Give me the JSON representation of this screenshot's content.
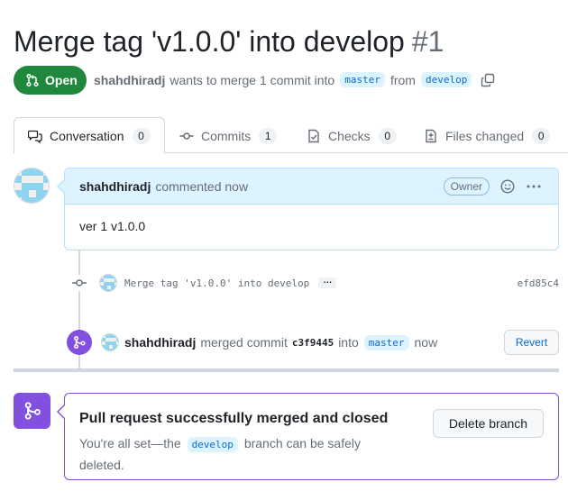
{
  "pr": {
    "title": "Merge tag 'v1.0.0' into develop",
    "number": "#1",
    "state": "Open",
    "author": "shahdhiradj",
    "summary_text": "wants to merge 1 commit into",
    "base_branch": "master",
    "from_text": "from",
    "head_branch": "develop"
  },
  "tabs": [
    {
      "label": "Conversation",
      "count": "0",
      "icon": "comment-discussion-icon",
      "active": true
    },
    {
      "label": "Commits",
      "count": "1",
      "icon": "git-commit-icon",
      "active": false
    },
    {
      "label": "Checks",
      "count": "0",
      "icon": "checklist-icon",
      "active": false
    },
    {
      "label": "Files changed",
      "count": "0",
      "icon": "file-diff-icon",
      "active": false
    }
  ],
  "comment": {
    "author": "shahdhiradj",
    "action": "commented now",
    "role_badge": "Owner",
    "body": "ver 1 v1.0.0"
  },
  "commit": {
    "message": "Merge tag 'v1.0.0' into develop",
    "ellipsis": "…",
    "sha": "efd85c4"
  },
  "merge_event": {
    "author": "shahdhiradj",
    "action": "merged commit",
    "sha": "c3f9445",
    "into_text": "into",
    "branch": "master",
    "time": "now",
    "revert_label": "Revert"
  },
  "merged_box": {
    "title": "Pull request successfully merged and closed",
    "desc_before": "You're all set—the",
    "branch": "develop",
    "desc_after": "branch can be safely deleted.",
    "delete_label": "Delete branch"
  },
  "colors": {
    "open_green": "#1f883d",
    "merged_purple": "#8250df",
    "link_blue": "#0969da",
    "comment_header_bg": "#ddf4ff"
  }
}
